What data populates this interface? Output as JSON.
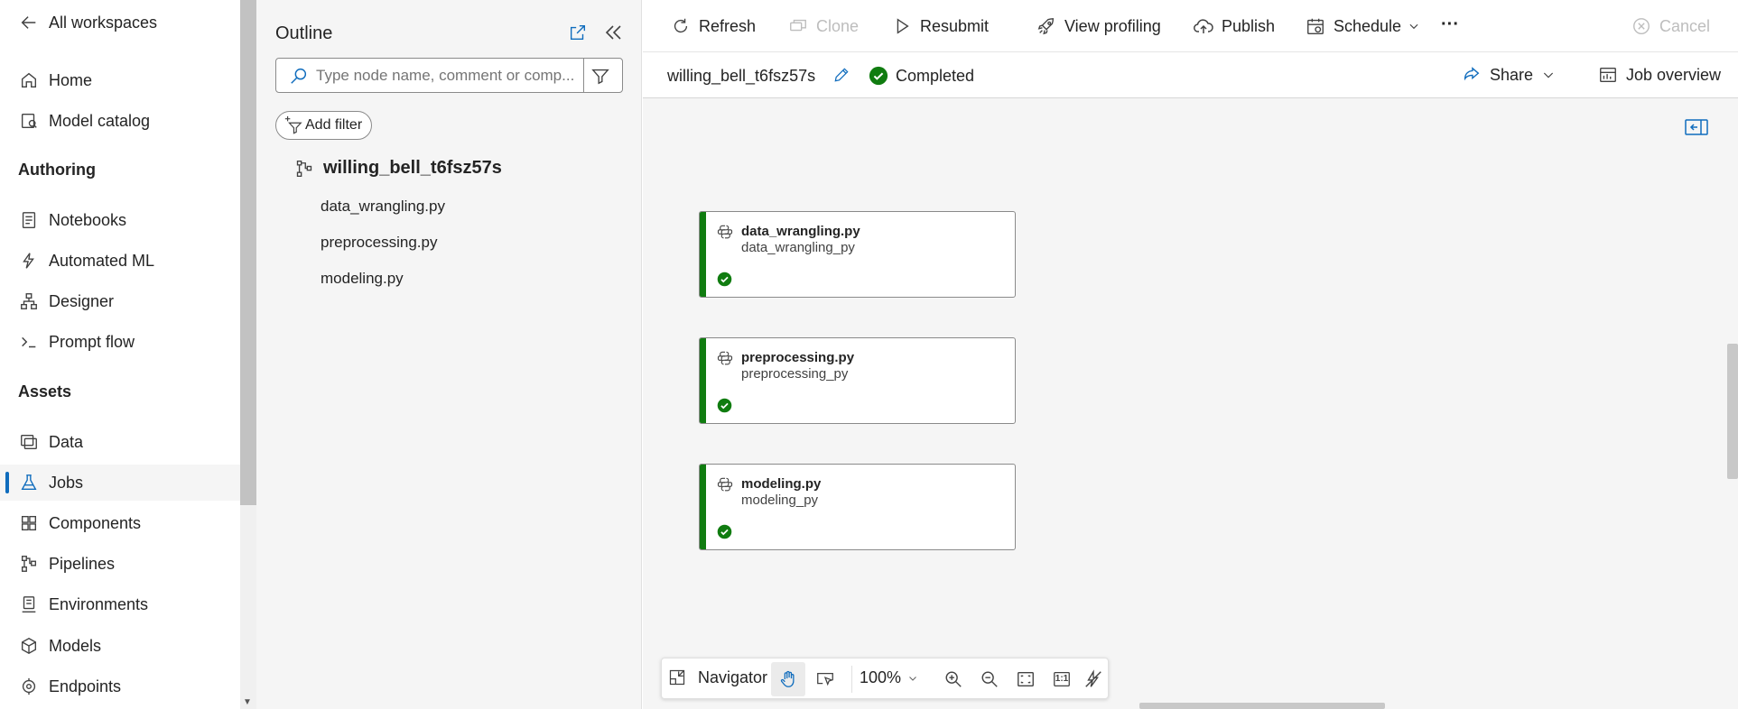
{
  "colors": {
    "accent": "#0f6cbd",
    "success": "#107c10",
    "canvas_bg": "#f5f5f5"
  },
  "leftnav": {
    "back_label": "All workspaces",
    "items_top": [
      {
        "label": "Home",
        "icon": "home-icon"
      },
      {
        "label": "Model catalog",
        "icon": "model-catalog-icon"
      }
    ],
    "section_authoring": "Authoring",
    "items_authoring": [
      {
        "label": "Notebooks",
        "icon": "notebook-icon"
      },
      {
        "label": "Automated ML",
        "icon": "automated-ml-icon"
      },
      {
        "label": "Designer",
        "icon": "designer-icon"
      },
      {
        "label": "Prompt flow",
        "icon": "prompt-flow-icon"
      }
    ],
    "section_assets": "Assets",
    "items_assets": [
      {
        "label": "Data",
        "icon": "data-icon"
      },
      {
        "label": "Jobs",
        "icon": "jobs-icon",
        "active": true
      },
      {
        "label": "Components",
        "icon": "components-icon"
      },
      {
        "label": "Pipelines",
        "icon": "pipelines-icon"
      },
      {
        "label": "Environments",
        "icon": "environments-icon"
      },
      {
        "label": "Models",
        "icon": "models-icon"
      },
      {
        "label": "Endpoints",
        "icon": "endpoints-icon"
      }
    ]
  },
  "outline": {
    "title": "Outline",
    "search_placeholder": "Type node name, comment or comp...",
    "add_filter_label": "Add filter",
    "root_label": "willing_bell_t6fsz57s",
    "children": [
      "data_wrangling.py",
      "preprocessing.py",
      "modeling.py"
    ]
  },
  "toolbar": {
    "refresh": "Refresh",
    "clone": "Clone",
    "resubmit": "Resubmit",
    "view_profiling": "View profiling",
    "publish": "Publish",
    "schedule": "Schedule",
    "more": "···",
    "cancel": "Cancel"
  },
  "job": {
    "name": "willing_bell_t6fsz57s",
    "status": "Completed",
    "share_label": "Share",
    "overview_label": "Job overview"
  },
  "nodes": [
    {
      "title": "data_wrangling.py",
      "subtitle": "data_wrangling_py",
      "status": "completed"
    },
    {
      "title": "preprocessing.py",
      "subtitle": "preprocessing_py",
      "status": "completed"
    },
    {
      "title": "modeling.py",
      "subtitle": "modeling_py",
      "status": "completed"
    }
  ],
  "canvas_toolbar": {
    "navigator_label": "Navigator",
    "zoom": "100%",
    "actual_size_label": "1:1"
  }
}
